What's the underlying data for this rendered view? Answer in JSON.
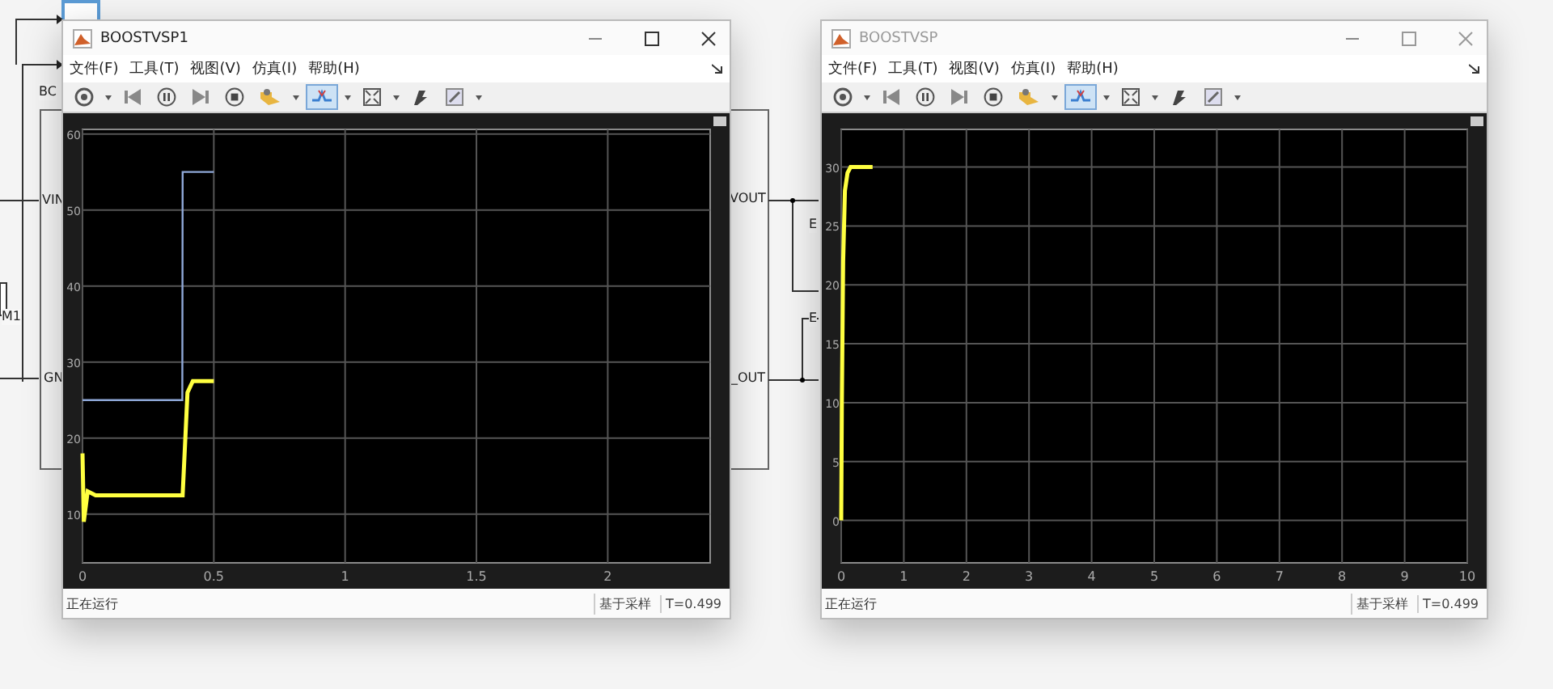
{
  "diagram": {
    "labels": [
      "BC",
      "VIN",
      "M1",
      "GN",
      "VOUT",
      "_OUT",
      "E",
      "E"
    ]
  },
  "windows": [
    {
      "title": "BOOSTVSP1",
      "active": true,
      "menu": [
        "文件(F)",
        "工具(T)",
        "视图(V)",
        "仿真(I)",
        "帮助(H)"
      ],
      "toolbar": [
        {
          "kind": "gear",
          "selected": false
        },
        {
          "kind": "caret",
          "selected": false
        },
        {
          "kind": "step-back",
          "selected": false
        },
        {
          "kind": "pause",
          "selected": false
        },
        {
          "kind": "step-forward",
          "selected": false
        },
        {
          "kind": "stop",
          "selected": false
        },
        {
          "kind": "highlight",
          "selected": false
        },
        {
          "kind": "caret",
          "selected": false
        },
        {
          "kind": "trigger",
          "selected": true
        },
        {
          "kind": "caret",
          "selected": false
        },
        {
          "kind": "zoom",
          "selected": false
        },
        {
          "kind": "caret",
          "selected": false
        },
        {
          "kind": "style",
          "selected": false
        },
        {
          "kind": "pen",
          "selected": false
        },
        {
          "kind": "caret",
          "selected": false
        }
      ],
      "chart_data": {
        "type": "line",
        "grid": true,
        "x": [
          0,
          0.005,
          0.02,
          0.05,
          0.38,
          0.381,
          0.4,
          0.42,
          0.5
        ],
        "xlim": [
          0,
          2.39
        ],
        "ylim": [
          3.6,
          60.6
        ],
        "xticks": [
          0,
          0.5,
          1,
          1.5,
          2
        ],
        "yticks": [
          10,
          20,
          30,
          40,
          50,
          60
        ],
        "series": [
          {
            "color": "#8fa8d8",
            "values": [
              25,
              25,
              25,
              25,
              25,
              55,
              55,
              55,
              55
            ]
          },
          {
            "color": "#ffff40",
            "values": [
              18,
              9,
              13,
              12.5,
              12.5,
              12.5,
              26,
              27.5,
              27.5
            ]
          }
        ]
      },
      "status": {
        "state": "正在运行",
        "mode": "基于采样",
        "time": "T=0.499"
      }
    },
    {
      "title": "BOOSTVSP",
      "active": false,
      "menu": [
        "文件(F)",
        "工具(T)",
        "视图(V)",
        "仿真(I)",
        "帮助(H)"
      ],
      "toolbar": [
        {
          "kind": "gear",
          "selected": false
        },
        {
          "kind": "caret",
          "selected": false
        },
        {
          "kind": "step-back",
          "selected": false
        },
        {
          "kind": "pause",
          "selected": false
        },
        {
          "kind": "step-forward",
          "selected": false
        },
        {
          "kind": "stop",
          "selected": false
        },
        {
          "kind": "highlight",
          "selected": false
        },
        {
          "kind": "caret",
          "selected": false
        },
        {
          "kind": "trigger",
          "selected": true
        },
        {
          "kind": "caret",
          "selected": false
        },
        {
          "kind": "zoom",
          "selected": false
        },
        {
          "kind": "caret",
          "selected": false
        },
        {
          "kind": "style",
          "selected": false
        },
        {
          "kind": "pen",
          "selected": false
        },
        {
          "kind": "caret",
          "selected": false
        }
      ],
      "chart_data": {
        "type": "line",
        "grid": true,
        "x": [
          0,
          0.01,
          0.03,
          0.06,
          0.1,
          0.15,
          0.3,
          0.5
        ],
        "xlim": [
          0,
          10
        ],
        "ylim": [
          -3.6,
          33.2
        ],
        "xticks": [
          0,
          1,
          2,
          3,
          4,
          5,
          6,
          7,
          8,
          9,
          10
        ],
        "yticks": [
          0,
          5,
          10,
          15,
          20,
          25,
          30
        ],
        "series": [
          {
            "color": "#ffff40",
            "values": [
              0,
              10,
              22,
              28,
              29.5,
              30,
              30,
              30
            ]
          }
        ]
      },
      "status": {
        "state": "正在运行",
        "mode": "基于采样",
        "time": "T=0.499"
      }
    }
  ]
}
